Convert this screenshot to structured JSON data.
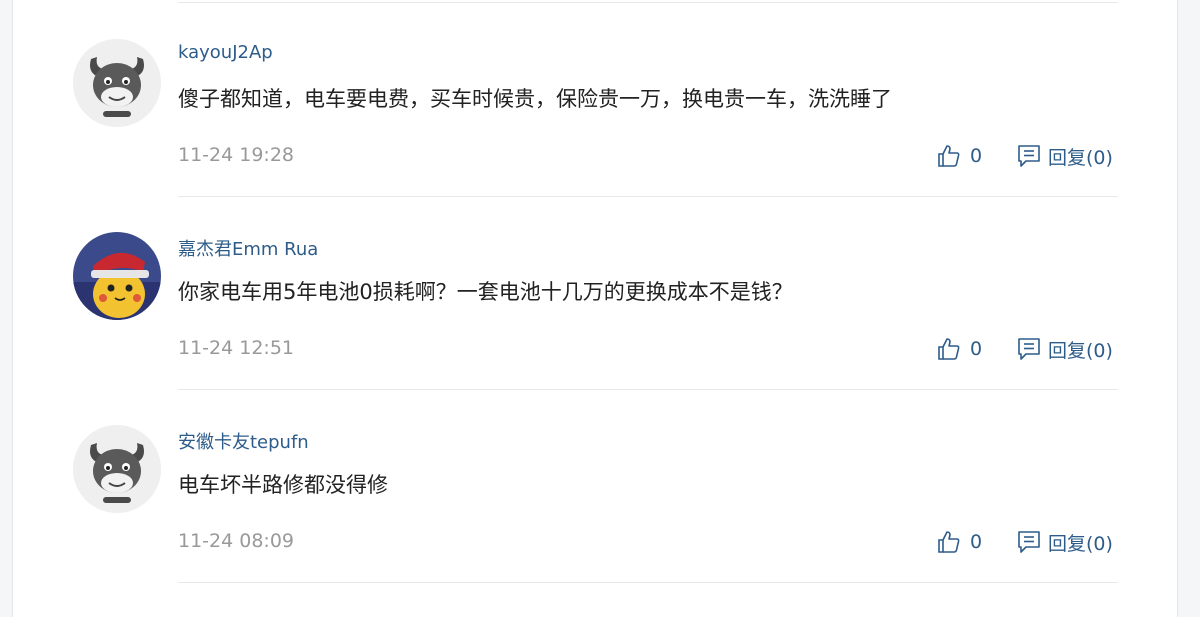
{
  "comments": [
    {
      "username": "kayouJ2Ap",
      "text": "傻子都知道，电车要电费，买车时候贵，保险贵一万，换电贵一车，洗洗睡了",
      "time": "11-24 19:28",
      "likes": "0",
      "reply_label": "回复(0)",
      "avatar": "default-mascot-avatar"
    },
    {
      "username": "嘉杰君Emm Rua",
      "text": "你家电车用5年电池0损耗啊？一套电池十几万的更换成本不是钱？",
      "time": "11-24 12:51",
      "likes": "0",
      "reply_label": "回复(0)",
      "avatar": "pikachu-avatar"
    },
    {
      "username": "安徽卡友tepufn",
      "text": "电车坏半路修都没得修",
      "time": "11-24 08:09",
      "likes": "0",
      "reply_label": "回复(0)",
      "avatar": "default-mascot-avatar"
    }
  ],
  "colors": {
    "username": "#2e5c8a",
    "body_text": "#222222",
    "meta_text": "#999999",
    "divider": "#e8e8e8"
  }
}
